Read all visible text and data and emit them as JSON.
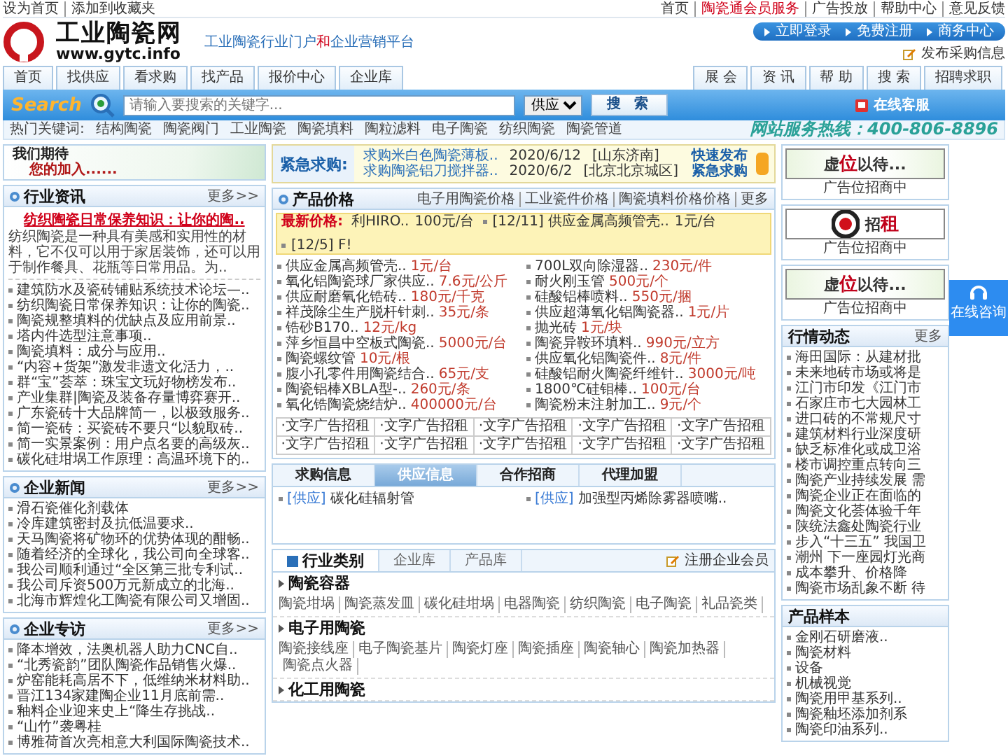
{
  "top_bar": {
    "left_links": [
      "设为首页",
      "添加到收藏夹"
    ],
    "right_links": [
      {
        "label": "首页",
        "highlighted": false
      },
      {
        "label": "陶瓷通会员服务",
        "highlighted": true
      },
      {
        "label": "广告投放",
        "highlighted": false
      },
      {
        "label": "帮助中心",
        "highlighted": false
      },
      {
        "label": "意见反馈",
        "highlighted": false
      }
    ]
  },
  "logo": {
    "name": "工业陶瓷网",
    "url": "www.gytc.info"
  },
  "slogan": [
    {
      "text": "工业陶瓷行业门户",
      "accent": false
    },
    {
      "text": "和",
      "accent": true
    },
    {
      "text": "企业营销平台",
      "accent": false
    }
  ],
  "member_bar": [
    "立即登录",
    "免费注册",
    "商务中心"
  ],
  "post_link": "发布采购信息",
  "nav_left": [
    "首页",
    "找供应",
    "看求购",
    "找产品",
    "报价中心",
    "企业库"
  ],
  "nav_right": [
    "展 会",
    "资 讯",
    "帮 助",
    "搜 索",
    "招聘求职"
  ],
  "search": {
    "logo": "Search",
    "placeholder": "请输入要搜索的关键字...",
    "category": "供应",
    "button": "搜 索",
    "online_link": "在线客服"
  },
  "hot_keywords": {
    "label": "热门关键词:",
    "items": [
      "结构陶瓷",
      "陶瓷阀门",
      "工业陶瓷",
      "陶瓷填料",
      "陶粒滤料",
      "电子陶瓷",
      "纺织陶瓷",
      "陶瓷管道"
    ],
    "hotline": "网站服务热线：400-806-8896"
  },
  "join_banner": [
    "我们期待",
    "您的加入......"
  ],
  "industry_news": {
    "title": "行业资讯",
    "more": "更多>>",
    "headline": "纺织陶瓷日常保养知识：让你的陶..",
    "summary": "纺织陶瓷是一种具有美感和实用性的材料，它不仅可以用于家居装饰，还可以用于制作餐具、花瓶等日常用品。为..",
    "items": [
      "建筑防水及瓷砖铺贴系统技术论坛—..",
      "纺织陶瓷日常保养知识：让你的陶瓷..",
      "陶瓷规整填料的优缺点及应用前景..",
      "塔内件选型注意事项..",
      "陶瓷填料：成分与应用..",
      "“内容+货架”激发非遗文化活力，..",
      "群“宝”荟萃：珠宝文玩好物榜发布..",
      "产业集群|陶瓷及装备存量博弈赛开..",
      "广东瓷砖十大品牌简一，以极致服务..",
      "简一瓷砖：买瓷砖不要只“以貌取砖..",
      "简一实景案例：用户点名要的高级灰..",
      "碳化硅坩埚工作原理：高温环境下的.."
    ]
  },
  "company_news": {
    "title": "企业新闻",
    "more": "更多>>",
    "items": [
      "滑石瓷催化剂载体",
      "冷库建筑密封及抗低温要求..",
      "天马陶瓷将矿物环的优势体现的酣畅..",
      "随着经济的全球化，我公司向全球客..",
      "我公司顺利通过“全区第三批专利试..",
      "我公司斥资500万元新成立的北海..",
      "北海市辉煌化工陶瓷有限公司又增固.."
    ]
  },
  "interviews": {
    "title": "企业专访",
    "more": "更多>>",
    "items": [
      "降本增效，法奥机器人助力CNC自..",
      "“北秀瓷韵”团队陶瓷作品销售火爆..",
      "炉窑能耗高居不下，低维纳米材料助..",
      "晋江134家建陶企业11月底前需..",
      "釉料企业迎来史上“降生存挑战..",
      "“山竹”袭粤桂",
      "博雅荷首次亮相意大利国际陶瓷技术.."
    ]
  },
  "urgent": {
    "label": "紧急求购:",
    "items": [
      {
        "title": "求购米白色陶瓷薄板..",
        "date": "2020/6/12",
        "place": "[山东济南]"
      },
      {
        "title": "求购陶瓷铝刀搅拌器..",
        "date": "2020/6/2",
        "place": "[北京北京城区]"
      }
    ],
    "quick_post": [
      "快速发布",
      "紧急求购"
    ]
  },
  "prices": {
    "title": "产品价格",
    "tabs": [
      "电子用陶瓷价格",
      "工业瓷件价格",
      "陶瓷填料价格价格",
      "更多"
    ],
    "latest_label": "最新价格:",
    "latest": [
      {
        "name": "利HIRO..",
        "price": "100元/台",
        "bullet": false
      },
      {
        "name": "[12/11] 供应金属高频管壳..",
        "price": "1元/台",
        "bullet": true
      },
      {
        "name": "[12/5] F!",
        "bullet": true
      }
    ],
    "items": [
      {
        "name": "供应金属高频管壳..",
        "price": "1元/台"
      },
      {
        "name": "700L双向除湿器..",
        "price": "230元/件"
      },
      {
        "name": "氧化铝陶瓷球厂家供应..",
        "price": "7.6元/公斤"
      },
      {
        "name": "耐火刚玉管",
        "price": "500元/个"
      },
      {
        "name": "供应耐磨氧化锆砖..",
        "price": "180元/千克"
      },
      {
        "name": "硅酸铝棒喷料..",
        "price": "550元/捆"
      },
      {
        "name": "祥茂除尘生产脱杆针刺..",
        "price": "35元/条"
      },
      {
        "name": "供应超薄氧化铝陶瓷器..",
        "price": "1元/片"
      },
      {
        "name": "锆砂B170..",
        "price": "12元/kg"
      },
      {
        "name": "抛光砖",
        "price": "1元/块"
      },
      {
        "name": "萍乡恒昌中空板式陶瓷..",
        "price": "5000元/台"
      },
      {
        "name": "陶瓷异鞍环填料..",
        "price": "990元/立方"
      },
      {
        "name": "陶瓷螺纹管",
        "price": "10元/根"
      },
      {
        "name": "供应氧化铝陶瓷件..",
        "price": "8元/件"
      },
      {
        "name": "腹小孔零件用陶瓷结合..",
        "price": "65元/支"
      },
      {
        "name": "硅酸铝耐火陶瓷纤维针..",
        "price": "3000元/吨"
      },
      {
        "name": "陶瓷铝棒XBLA型-..",
        "price": "260元/条"
      },
      {
        "name": "1800℃硅钼棒..",
        "price": "100元/台"
      },
      {
        "name": "氧化锆陶瓷烧结炉..",
        "price": "400000元/台"
      },
      {
        "name": "陶瓷粉末注射加工..",
        "price": "9元/个"
      }
    ],
    "ads": [
      "·文字广告招租",
      "·文字广告招租",
      "·文字广告招租",
      "·文字广告招租",
      "·文字广告招租",
      "·文字广告招租",
      "·文字广告招租",
      "·文字广告招租",
      "·文字广告招租",
      "·文字广告招租"
    ]
  },
  "info_tabs": {
    "tabs": [
      {
        "label": "求购信息",
        "selected": false
      },
      {
        "label": "供应信息",
        "selected": true
      },
      {
        "label": "合作招商",
        "selected": false
      },
      {
        "label": "代理加盟",
        "selected": false
      }
    ],
    "items": [
      {
        "tag": "[供应]",
        "text": "碳化硅辐射管"
      },
      {
        "tag": "[供应]",
        "text": "加强型丙烯除雾器喷嘴.."
      }
    ]
  },
  "categories": {
    "tabs": [
      {
        "label": "行业类别",
        "selected": true
      },
      {
        "label": "企业库",
        "selected": false
      },
      {
        "label": "产品库",
        "selected": false
      }
    ],
    "register_link": "注册企业会员",
    "groups": [
      {
        "title": "陶瓷容器",
        "links": [
          "陶瓷坩埚",
          "陶瓷蒸发皿",
          "碳化硅坩埚",
          "电器陶瓷",
          "纺织陶瓷",
          "电子陶瓷",
          "礼品瓷类"
        ]
      },
      {
        "title": "电子用陶瓷",
        "links": [
          "陶瓷接线座",
          "电子陶瓷基片",
          "陶瓷灯座",
          "陶瓷插座",
          "陶瓷轴心",
          "陶瓷加热器",
          "陶瓷点火器"
        ]
      },
      {
        "title": "化工用陶瓷"
      }
    ]
  },
  "ad_slots": [
    {
      "kind": "wait",
      "banner": "虚位以待...",
      "caption": "广告位招商中"
    },
    {
      "kind": "rent",
      "banner": "招租",
      "caption": "广告位招商中"
    },
    {
      "kind": "wait",
      "banner": "虚位以待...",
      "caption": "广告位招商中"
    }
  ],
  "market": {
    "title": "行情动态",
    "more": "更多",
    "items": [
      "海田国际：从建材批",
      "未来地砖市场或将是",
      "江门市印发《江门市",
      "石家庄市七大园林工",
      "进口砖的不常规尺寸",
      "建筑材料行业深度研",
      "缺乏标准化或成卫浴",
      "楼市调控重点转向三",
      "陶瓷产业持续发展 需",
      "陶瓷企业正在面临的",
      "陶瓷文化荟体验千年",
      "陕统法鑫处陶瓷行业",
      "步入“十三五” 我国卫",
      "潮州 下一座园灯光商",
      "成本攀升、价格降",
      "陶瓷市场乱象不断 待"
    ]
  },
  "samples": {
    "title": "产品样本",
    "items": [
      "金刚石研磨液..",
      "陶瓷材料",
      "设备",
      "机械视觉",
      "陶瓷用甲基系列..",
      "陶瓷釉坯添加剂系",
      "陶瓷印油系列.."
    ]
  },
  "float_button": "在线咨询"
}
